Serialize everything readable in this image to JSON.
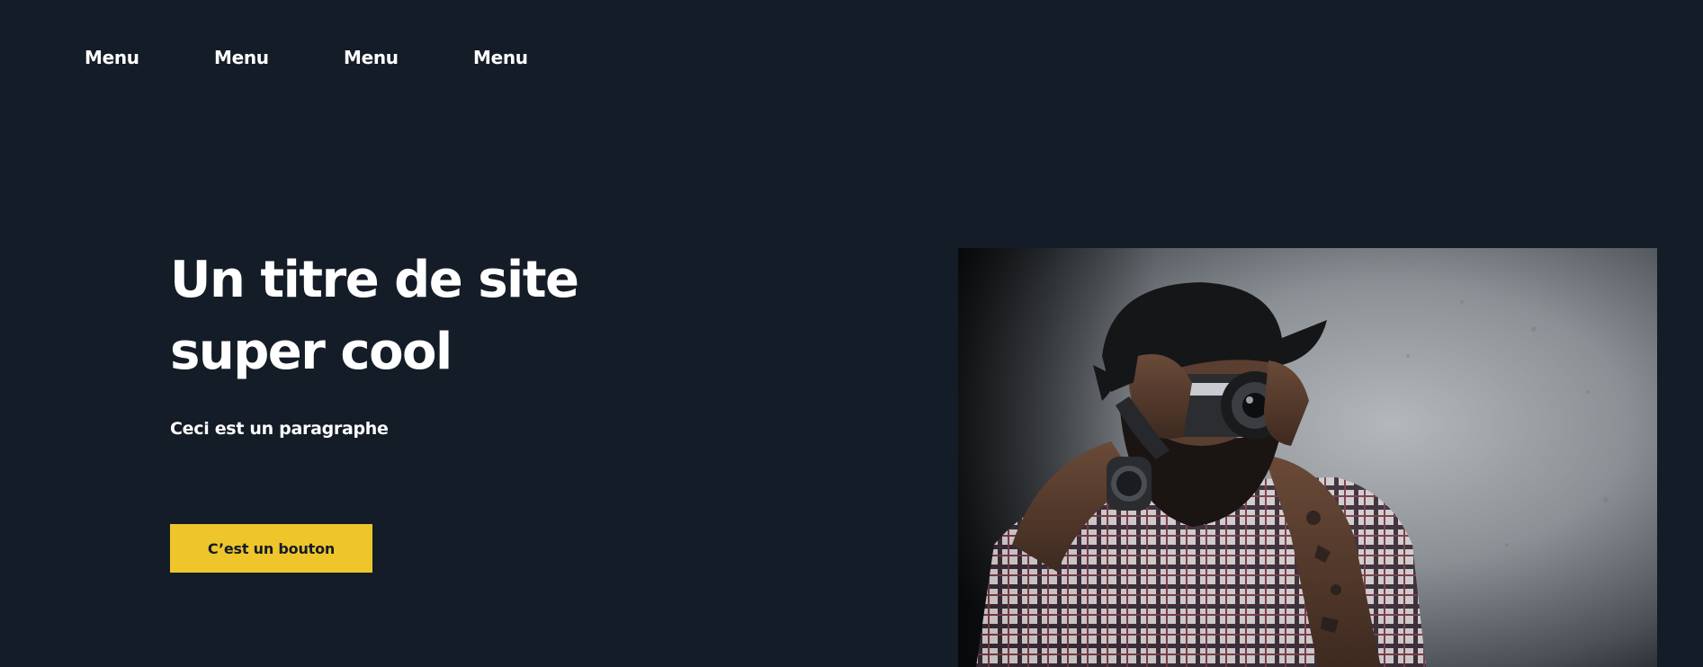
{
  "nav": {
    "items": [
      {
        "label": "Menu"
      },
      {
        "label": "Menu"
      },
      {
        "label": "Menu"
      },
      {
        "label": "Menu"
      }
    ]
  },
  "hero": {
    "title": "Un titre de site super cool",
    "paragraph": "Ceci est un paragraphe",
    "button_label": "C’est un bouton",
    "image_alt": "photographer-with-camera-image"
  },
  "colors": {
    "background": "#141c27",
    "text": "#ffffff",
    "accent": "#eec52b"
  }
}
